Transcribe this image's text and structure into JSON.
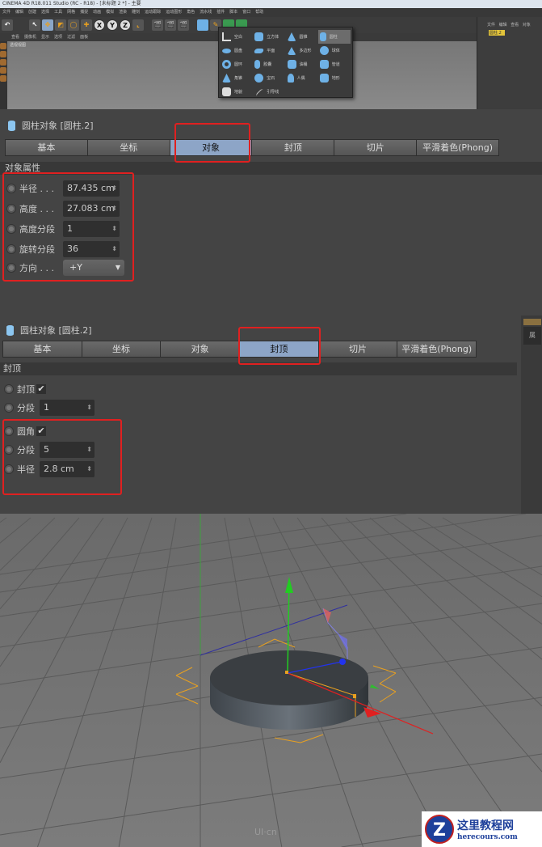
{
  "window": {
    "title": "CINEMA 4D R18.011 Studio (RC - R18) - [未标题 2 *] - 主要"
  },
  "menu": [
    "文件",
    "编辑",
    "创建",
    "选择",
    "工具",
    "网格",
    "捕捉",
    "动画",
    "模拟",
    "渲染",
    "雕刻",
    "运动跟踪",
    "运动图形",
    "角色",
    "流水线",
    "插件",
    "脚本",
    "窗口",
    "帮助"
  ],
  "toolbar": {
    "x": "X",
    "y": "Y",
    "z": "Z"
  },
  "viewport_menu": [
    "查看",
    "摄像机",
    "显示",
    "选项",
    "过滤",
    "面板"
  ],
  "viewport_label": "透视视图",
  "object_manager": {
    "menu": [
      "文件",
      "编辑",
      "查看",
      "对象"
    ],
    "object": "圆柱.2"
  },
  "popup": {
    "items": [
      "空白",
      "立方体",
      "圆锥",
      "圆柱",
      "圆盘",
      "平面",
      "多边形",
      "球体",
      "圆环",
      "胶囊",
      "油桶",
      "管道",
      "角锥",
      "宝石",
      "人偶",
      "地形",
      "地貌",
      "引导线"
    ],
    "selected": "圆柱"
  },
  "panel1": {
    "title": "圆柱对象 [圆柱.2]",
    "tabs": [
      "基本",
      "坐标",
      "对象",
      "封顶",
      "切片",
      "平滑着色(Phong)"
    ],
    "active_tab": "对象",
    "section": "对象属性",
    "rows": [
      {
        "label": "半径 . . .",
        "value": "87.435 cm"
      },
      {
        "label": "高度 . . .",
        "value": "27.083 cm"
      },
      {
        "label": "高度分段",
        "value": "1"
      },
      {
        "label": "旋转分段",
        "value": "36"
      },
      {
        "label": "方向 . . .",
        "value": "+Y"
      }
    ]
  },
  "panel2": {
    "title": "圆柱对象 [圆柱.2]",
    "tabs": [
      "基本",
      "坐标",
      "对象",
      "封顶",
      "切片",
      "平滑着色(Phong)"
    ],
    "active_tab": "封顶",
    "section": "封顶",
    "rows": [
      {
        "label": "封顶",
        "checked": true
      },
      {
        "label": "分段",
        "value": "1"
      },
      {
        "label": "圆角",
        "checked": true
      },
      {
        "label": "分段",
        "value": "5"
      },
      {
        "label": "半径",
        "value": "2.8 cm"
      }
    ],
    "side_label": "属"
  },
  "watermark": "UI·cn",
  "logo": {
    "title": "这里教程网",
    "url_text": "herecours.com",
    "letter": "Z"
  },
  "colors": {
    "highlight": "#e02020",
    "active_tab": "#8da5c7",
    "x_axis": "#e02020",
    "y_axis": "#22cc22",
    "z_axis": "#2233ee",
    "bounding": "#e8a020"
  }
}
